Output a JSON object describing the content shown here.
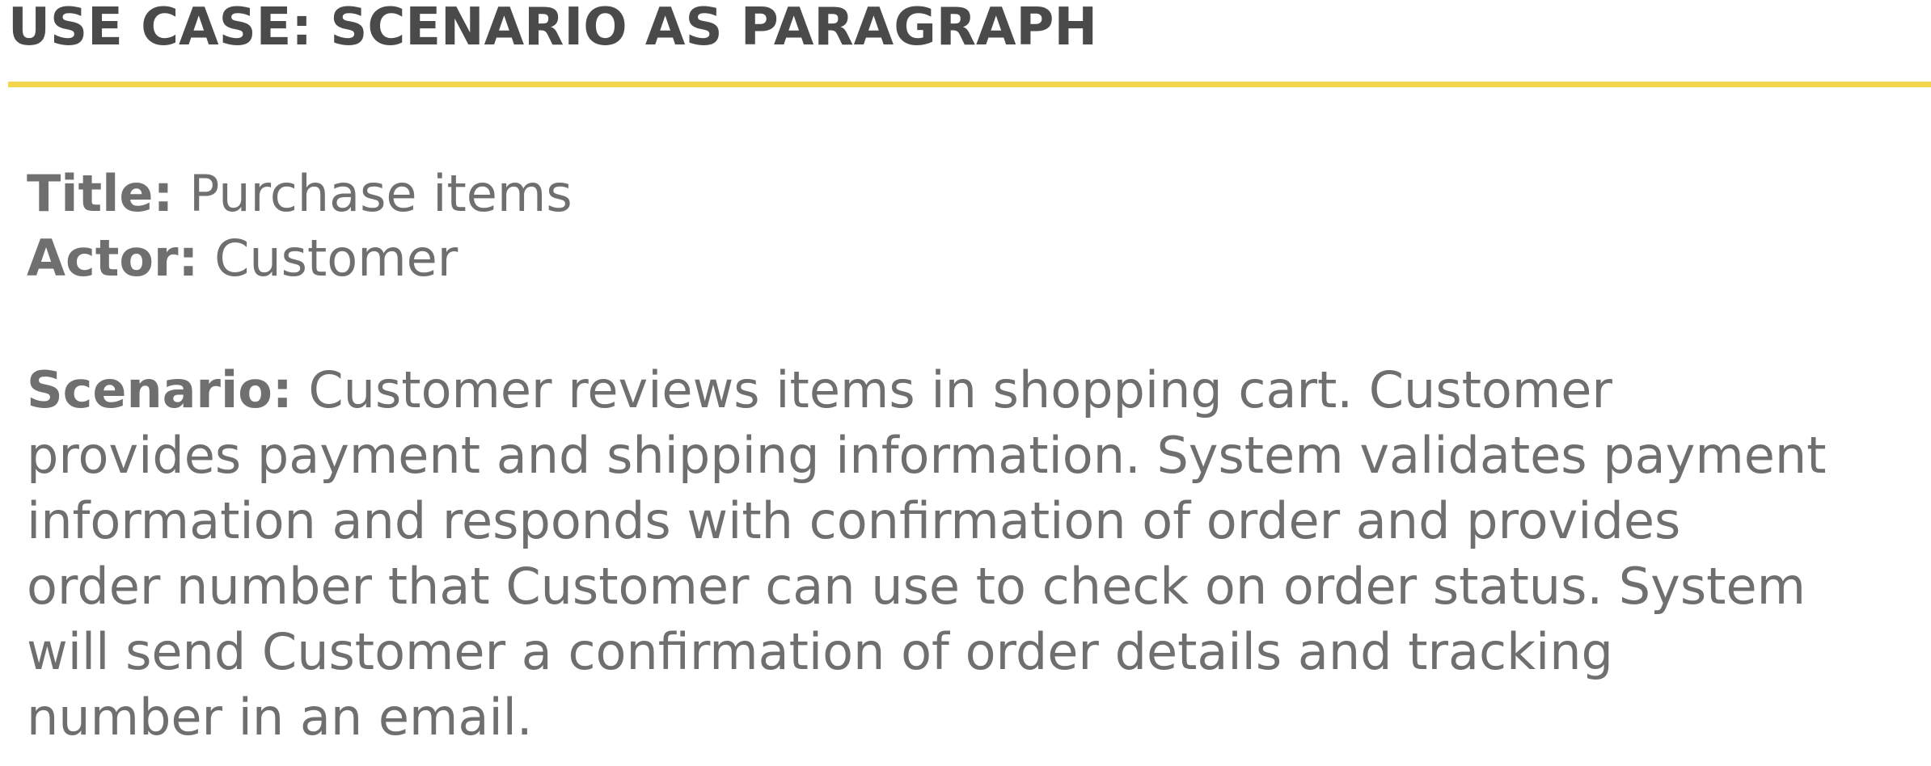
{
  "slide": {
    "heading": "USE CASE: SCENARIO AS PARAGRAPH",
    "accent_color": "#f2d74e"
  },
  "use_case": {
    "title_label": "Title:",
    "title_value": "Purchase items",
    "actor_label": "Actor:",
    "actor_value": "Customer",
    "scenario_label": "Scenario:",
    "scenario_lines": [
      "Customer reviews items in shopping cart. Customer",
      "provides payment and shipping information. System validates payment",
      "information and responds with confirmation of order and provides",
      "order number that Customer can use to check on order status. System",
      "will send Customer a confirmation of order details and tracking",
      "number in an email."
    ]
  }
}
